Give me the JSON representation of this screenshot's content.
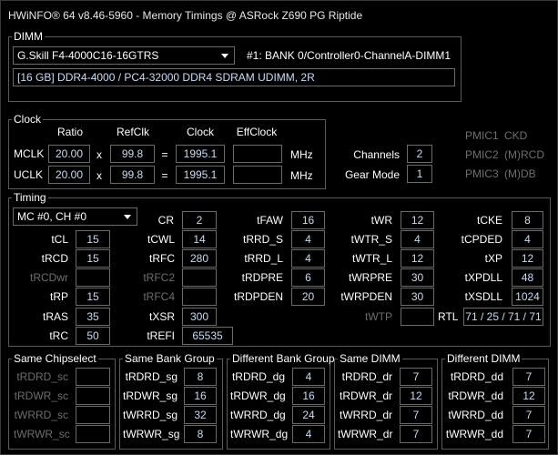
{
  "title": "HWiNFO® 64 v8.46-5960 - Memory Timings @ ASRock Z690 PG Riptide",
  "dimm": {
    "group_label": "DIMM",
    "module_select": "G.Skill F4-4000C16-16GTRS",
    "slot_label": "#1: BANK 0/Controller0-ChannelA-DIMM1",
    "info": "[16 GB] DDR4-4000 / PC4-32000 DDR4 SDRAM UDIMM, 2R"
  },
  "clock": {
    "group_label": "Clock",
    "hdr_ratio": "Ratio",
    "hdr_refclk": "RefClk",
    "hdr_clock": "Clock",
    "hdr_effclock": "EffClock",
    "mclk_label": "MCLK",
    "mclk_ratio": "20.00",
    "mclk_refclk": "99.8",
    "mclk_clock": "1995.1",
    "mclk_eff": "",
    "uclk_label": "UCLK",
    "uclk_ratio": "20.00",
    "uclk_refclk": "99.8",
    "uclk_clock": "1995.1",
    "uclk_eff": "",
    "times": "x",
    "equals": "=",
    "unit": "MHz",
    "channels_label": "Channels",
    "channels_value": "2",
    "gear_label": "Gear Mode",
    "gear_value": "1",
    "pmic1": "PMIC1",
    "pmic1_v": "CKD",
    "pmic2": "PMIC2",
    "pmic2_v": "(M)RCD",
    "pmic3": "PMIC3",
    "pmic3_v": "(M)DB"
  },
  "timing": {
    "group_label": "Timing",
    "channel_select": "MC #0, CH #0",
    "cr": {
      "label": "CR",
      "value": "2"
    },
    "cl": {
      "label": "tCL",
      "value": "15"
    },
    "rcd": {
      "label": "tRCD",
      "value": "15"
    },
    "rcdwr": {
      "label": "tRCDwr",
      "value": ""
    },
    "rp": {
      "label": "tRP",
      "value": "15"
    },
    "ras": {
      "label": "tRAS",
      "value": "35"
    },
    "rc": {
      "label": "tRC",
      "value": "50"
    },
    "cwl": {
      "label": "tCWL",
      "value": "14"
    },
    "rfc": {
      "label": "tRFC",
      "value": "280"
    },
    "rfc2": {
      "label": "tRFC2",
      "value": ""
    },
    "rfc4": {
      "label": "tRFC4",
      "value": ""
    },
    "xsr": {
      "label": "tXSR",
      "value": "300"
    },
    "refi": {
      "label": "tREFI",
      "value": "65535"
    },
    "faw": {
      "label": "tFAW",
      "value": "16"
    },
    "rrd_s": {
      "label": "tRRD_S",
      "value": "4"
    },
    "rrd_l": {
      "label": "tRRD_L",
      "value": "4"
    },
    "rdpre": {
      "label": "tRDPRE",
      "value": "6"
    },
    "rdpden": {
      "label": "tRDPDEN",
      "value": "20"
    },
    "wr": {
      "label": "tWR",
      "value": "12"
    },
    "wtr_s": {
      "label": "tWTR_S",
      "value": "4"
    },
    "wtr_l": {
      "label": "tWTR_L",
      "value": "12"
    },
    "wrpre": {
      "label": "tWRPRE",
      "value": "30"
    },
    "wrpden": {
      "label": "tWRPDEN",
      "value": "30"
    },
    "wtp": {
      "label": "tWTP",
      "value": ""
    },
    "cke": {
      "label": "tCKE",
      "value": "8"
    },
    "cpded": {
      "label": "tCPDED",
      "value": "4"
    },
    "xp": {
      "label": "tXP",
      "value": "12"
    },
    "xpdll": {
      "label": "tXPDLL",
      "value": "48"
    },
    "xsdll": {
      "label": "tXSDLL",
      "value": "1024"
    },
    "rtl": {
      "label": "RTL",
      "value": "71 / 25 / 71 / 71"
    }
  },
  "same_cs": {
    "group_label": "Same Chipselect",
    "rows": [
      {
        "label": "tRDRD_sc",
        "value": ""
      },
      {
        "label": "tRDWR_sc",
        "value": ""
      },
      {
        "label": "tWRRD_sc",
        "value": ""
      },
      {
        "label": "tWRWR_sc",
        "value": ""
      }
    ]
  },
  "same_bg": {
    "group_label": "Same Bank Group",
    "rows": [
      {
        "label": "tRDRD_sg",
        "value": "8"
      },
      {
        "label": "tRDWR_sg",
        "value": "16"
      },
      {
        "label": "tWRRD_sg",
        "value": "32"
      },
      {
        "label": "tWRWR_sg",
        "value": "8"
      }
    ]
  },
  "diff_bg": {
    "group_label": "Different Bank Group",
    "rows": [
      {
        "label": "tRDRD_dg",
        "value": "4"
      },
      {
        "label": "tRDWR_dg",
        "value": "16"
      },
      {
        "label": "tWRRD_dg",
        "value": "24"
      },
      {
        "label": "tWRWR_dg",
        "value": "4"
      }
    ]
  },
  "same_dimm": {
    "group_label": "Same DIMM",
    "rows": [
      {
        "label": "tRDRD_dr",
        "value": "7"
      },
      {
        "label": "tRDWR_dr",
        "value": "12"
      },
      {
        "label": "tWRRD_dr",
        "value": "7"
      },
      {
        "label": "tWRWR_dr",
        "value": "7"
      }
    ]
  },
  "diff_dimm": {
    "group_label": "Different DIMM",
    "rows": [
      {
        "label": "tRDRD_dd",
        "value": "7"
      },
      {
        "label": "tRDWR_dd",
        "value": "12"
      },
      {
        "label": "tWRRD_dd",
        "value": "7"
      },
      {
        "label": "tWRWR_dd",
        "value": "7"
      }
    ]
  }
}
